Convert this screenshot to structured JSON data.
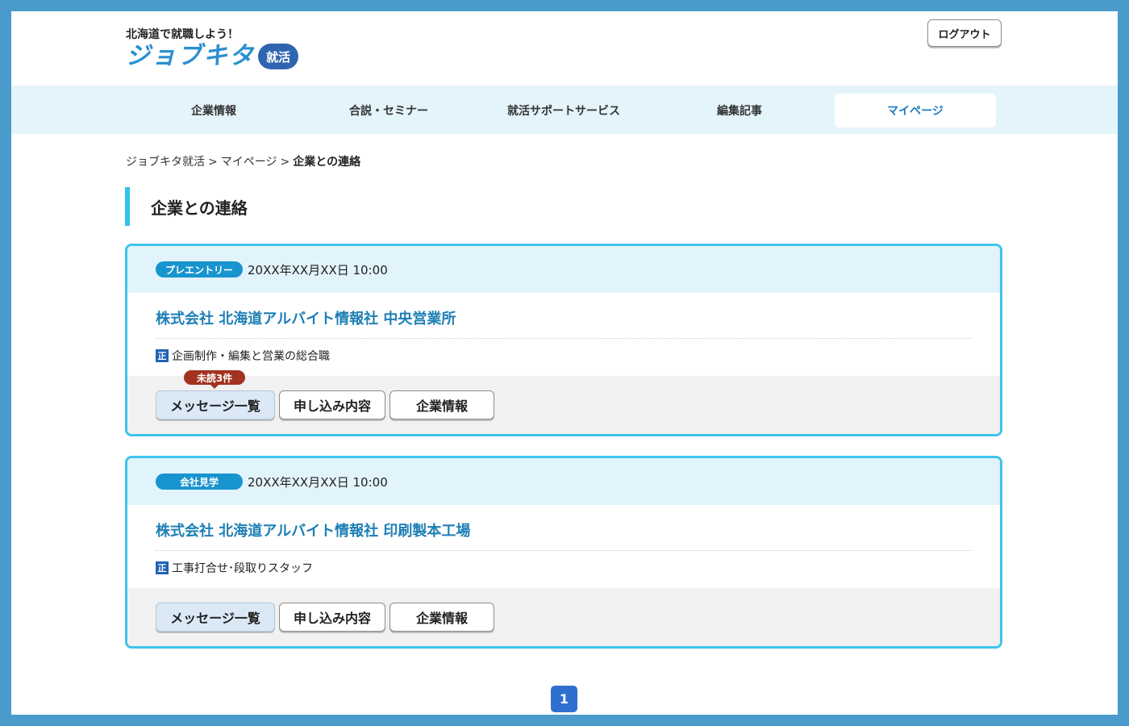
{
  "header": {
    "tagline": "北海道で就職しよう！",
    "logo_text": "ジョブキタ",
    "logo_badge": "就活",
    "logout_label": "ログアウト"
  },
  "nav": {
    "items": [
      {
        "label": "企業情報"
      },
      {
        "label": "合説・セミナー"
      },
      {
        "label": "就活サポートサービス"
      },
      {
        "label": "編集記事"
      },
      {
        "label": "マイページ"
      }
    ],
    "active_index": 4
  },
  "breadcrumb": {
    "items": [
      "ジョブキタ就活",
      "マイページ"
    ],
    "separator": ">",
    "current": "企業との連絡"
  },
  "page_title": "企業との連絡",
  "cards": [
    {
      "tag": "プレエントリー",
      "date": "20XX年XX月XX日 10:00",
      "company": "株式会社 北海道アルバイト情報社 中央営業所",
      "job_icon": "正",
      "job": "企画制作・編集と営業の総合職",
      "unread": "未読3件",
      "buttons": {
        "messages": "メッセージ一覧",
        "application": "申し込み内容",
        "company_info": "企業情報"
      }
    },
    {
      "tag": "会社見学",
      "date": "20XX年XX月XX日 10:00",
      "company": "株式会社 北海道アルバイト情報社 印刷製本工場",
      "job_icon": "正",
      "job": "工事打合せ･段取りスタッフ",
      "buttons": {
        "messages": "メッセージ一覧",
        "application": "申し込み内容",
        "company_info": "企業情報"
      }
    }
  ],
  "pagination": {
    "current": "1"
  },
  "colors": {
    "outer_frame": "#4a9bcb",
    "nav_bg": "#e4f4fb",
    "accent": "#3ec4ec",
    "company_link": "#1d7fb5",
    "tag_bg": "#1894cf",
    "unread_badge": "#a33220",
    "pager_bg": "#2e6fd0"
  }
}
